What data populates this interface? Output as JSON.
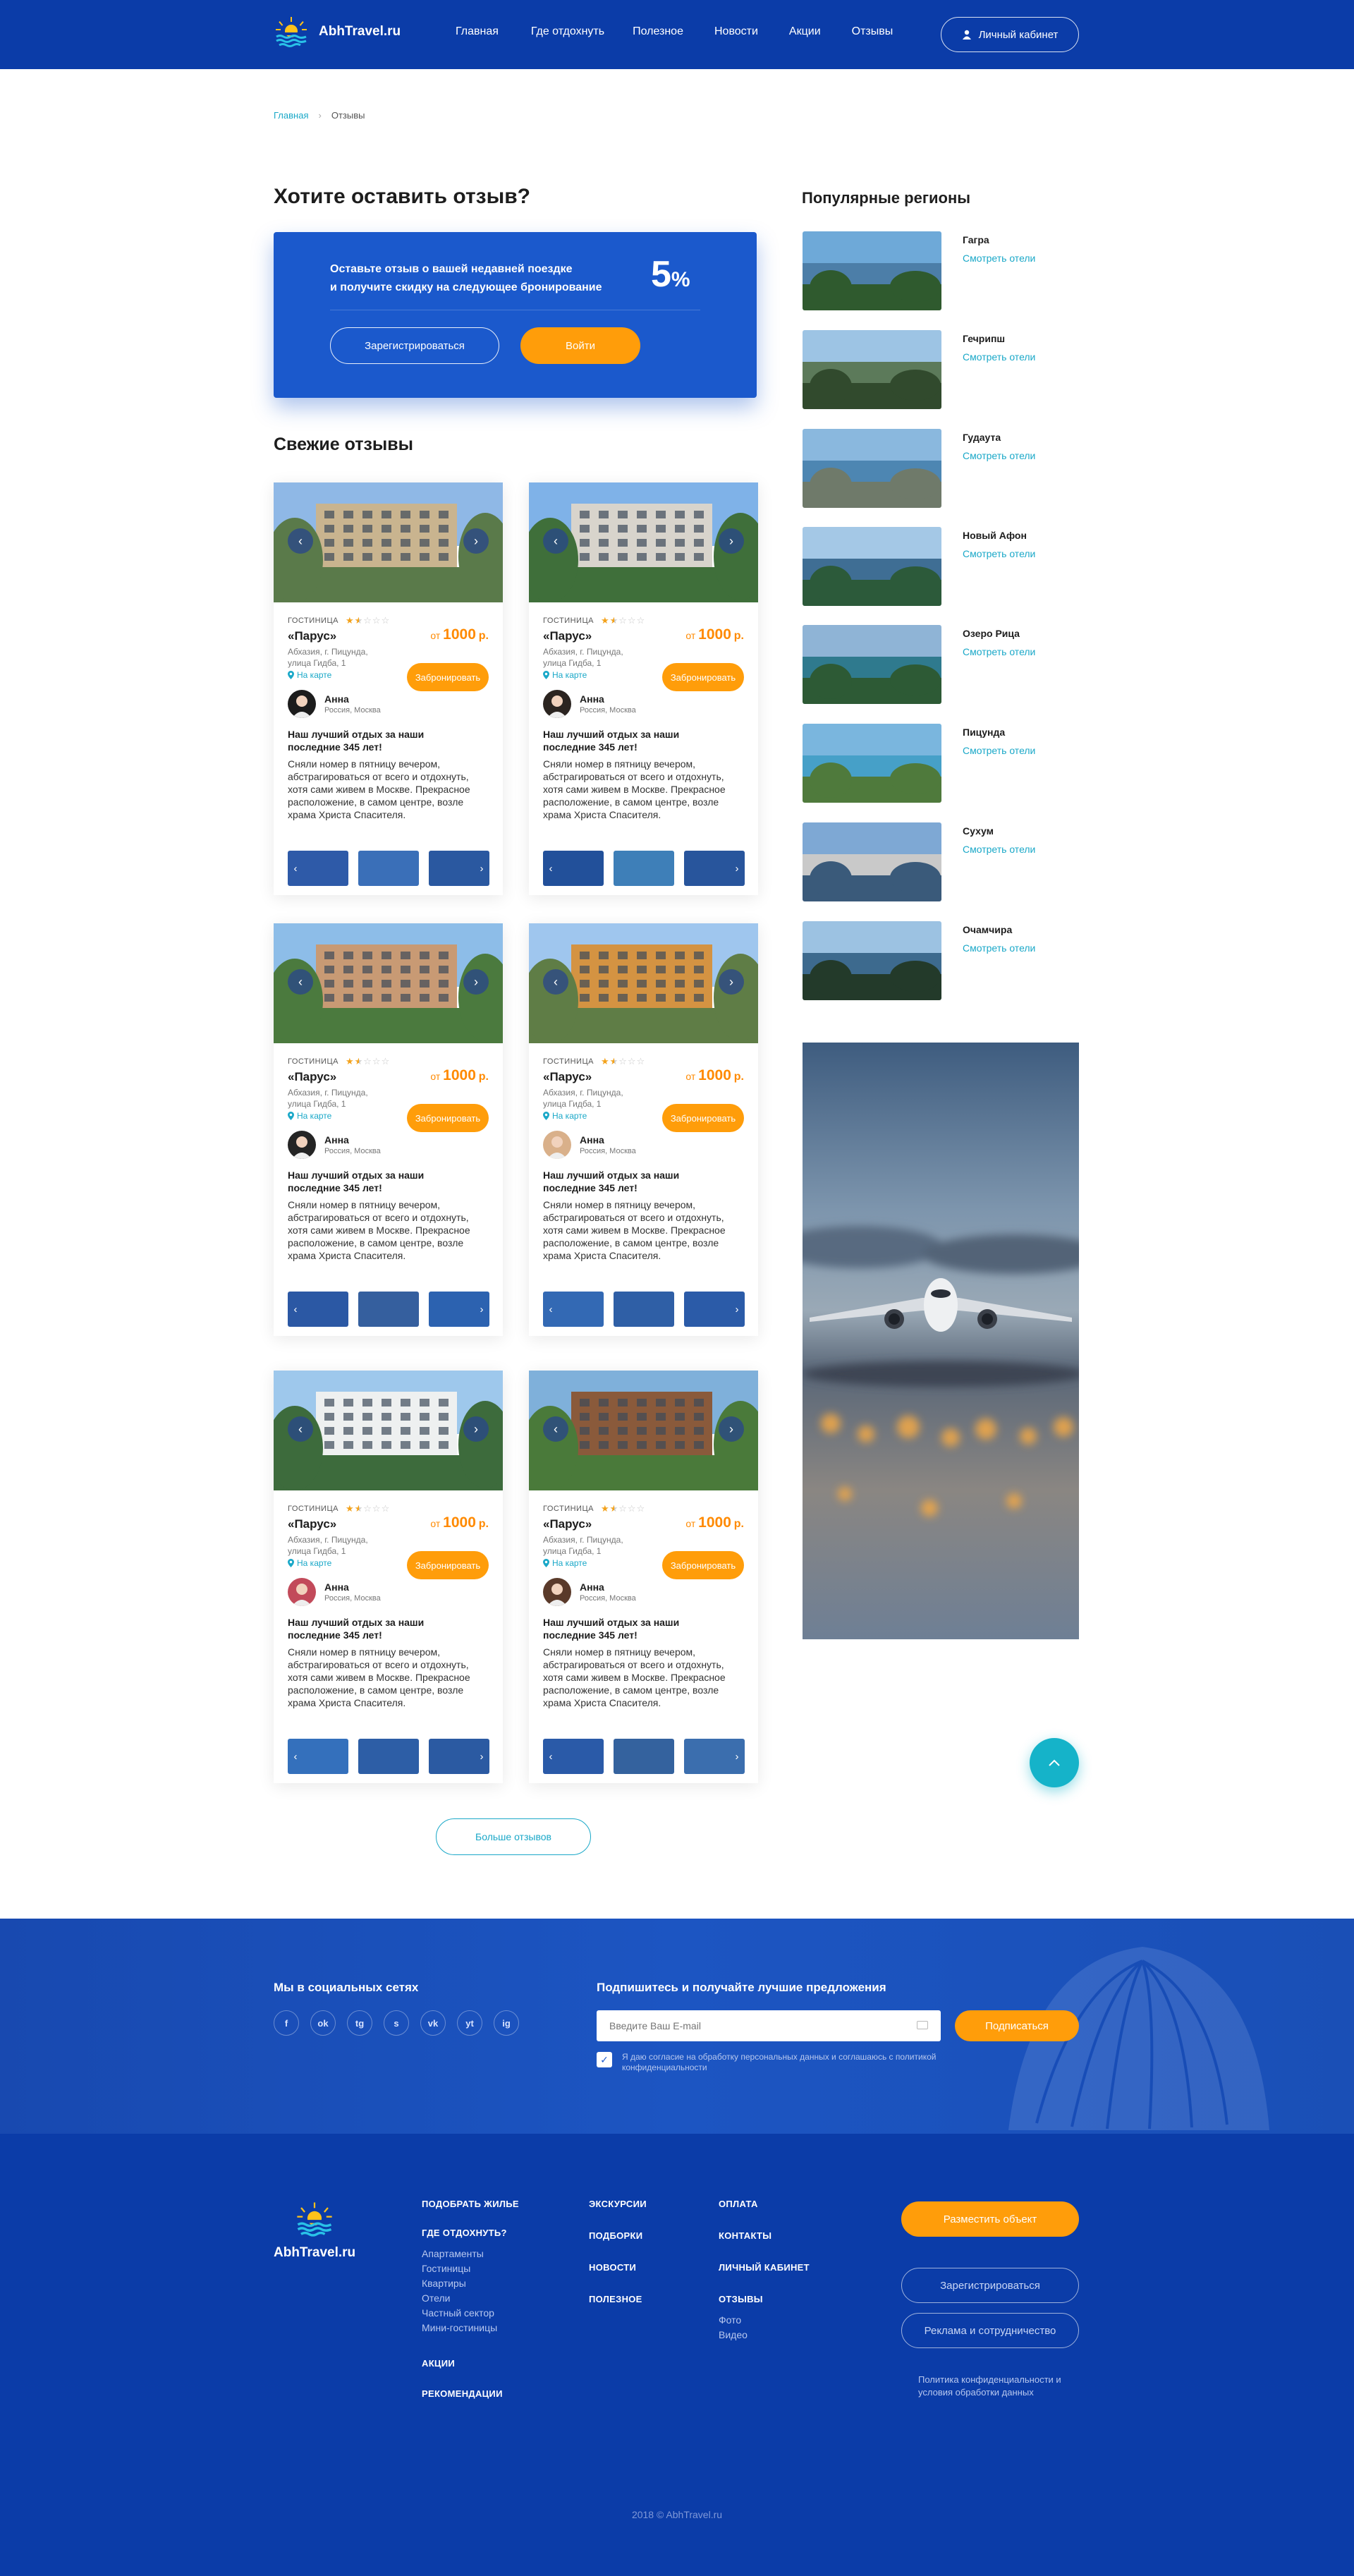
{
  "header": {
    "logo": "AbhTravel.ru",
    "nav": [
      "Главная",
      "Где отдохнуть",
      "Полезное",
      "Новости",
      "Акции",
      "Отзывы"
    ],
    "cabinet": "Личный кабинет"
  },
  "breadcrumb": {
    "home": "Главная",
    "sep": "›",
    "current": "Отзывы"
  },
  "review_cta": {
    "title": "Хотите оставить отзыв?",
    "text_1": "Оставьте отзыв о вашей недавней поездке",
    "text_2": "и получите скидку на следующее бронирование",
    "discount": "5",
    "discount_unit": "%",
    "register": "Зарегистрироваться",
    "login": "Войти"
  },
  "fresh_title": "Свежие отзывы",
  "cards": [
    {
      "type": "ГОСТИНИЦА",
      "name": "«Парус»",
      "price_from": "от",
      "price": "1000",
      "currency": "р.",
      "addr_1": "Абхазия, г. Пицунда,",
      "addr_2": "улица Гидба, 1",
      "map": "На карте",
      "book": "Забронировать",
      "user": "Анна",
      "loc": "Россия, Москва",
      "title": "Наш лучший отдых за наши последние 345 лет!",
      "text": "Сняли номер в пятницу вечером, абстрагироваться от всего и отдохнуть, хотя сами живем в Москве. Прекрасное расположение, в самом центре, возле храма Христа Спасителя."
    },
    {
      "type": "ГОСТИНИЦА",
      "name": "«Парус»",
      "price_from": "от",
      "price": "1000",
      "currency": "р.",
      "addr_1": "Абхазия, г. Пицунда,",
      "addr_2": "улица Гидба, 1",
      "map": "На карте",
      "book": "Забронировать",
      "user": "Анна",
      "loc": "Россия, Москва",
      "title": "Наш лучший отдых за наши последние 345 лет!",
      "text": "Сняли номер в пятницу вечером, абстрагироваться от всего и отдохнуть, хотя сами живем в Москве. Прекрасное расположение, в самом центре, возле храма Христа Спасителя."
    },
    {
      "type": "ГОСТИНИЦА",
      "name": "«Парус»",
      "price_from": "от",
      "price": "1000",
      "currency": "р.",
      "addr_1": "Абхазия, г. Пицунда,",
      "addr_2": "улица Гидба, 1",
      "map": "На карте",
      "book": "Забронировать",
      "user": "Анна",
      "loc": "Россия, Москва",
      "title": "Наш лучший отдых за наши последние 345 лет!",
      "text": "Сняли номер в пятницу вечером, абстрагироваться от всего и отдохнуть, хотя сами живем в Москве. Прекрасное расположение, в самом центре, возле храма Христа Спасителя."
    },
    {
      "type": "ГОСТИНИЦА",
      "name": "«Парус»",
      "price_from": "от",
      "price": "1000",
      "currency": "р.",
      "addr_1": "Абхазия, г. Пицунда,",
      "addr_2": "улица Гидба, 1",
      "map": "На карте",
      "book": "Забронировать",
      "user": "Анна",
      "loc": "Россия, Москва",
      "title": "Наш лучший отдых за наши последние 345 лет!",
      "text": "Сняли номер в пятницу вечером, абстрагироваться от всего и отдохнуть, хотя сами живем в Москве. Прекрасное расположение, в самом центре, возле храма Христа Спасителя."
    },
    {
      "type": "ГОСТИНИЦА",
      "name": "«Парус»",
      "price_from": "от",
      "price": "1000",
      "currency": "р.",
      "addr_1": "Абхазия, г. Пицунда,",
      "addr_2": "улица Гидба, 1",
      "map": "На карте",
      "book": "Забронировать",
      "user": "Анна",
      "loc": "Россия, Москва",
      "title": "Наш лучший отдых за наши последние 345 лет!",
      "text": "Сняли номер в пятницу вечером, абстрагироваться от всего и отдохнуть, хотя сами живем в Москве. Прекрасное расположение, в самом центре, возле храма Христа Спасителя."
    },
    {
      "type": "ГОСТИНИЦА",
      "name": "«Парус»",
      "price_from": "от",
      "price": "1000",
      "currency": "р.",
      "addr_1": "Абхазия, г. Пицунда,",
      "addr_2": "улица Гидба, 1",
      "map": "На карте",
      "book": "Забронировать",
      "user": "Анна",
      "loc": "Россия, Москва",
      "title": "Наш лучший отдых за наши последние 345 лет!",
      "text": "Сняли номер в пятницу вечером, абстрагироваться от всего и отдохнуть, хотя сами живем в Москве. Прекрасное расположение, в самом центре, возле храма Христа Спасителя."
    }
  ],
  "rating": 1.5,
  "rating_max": 5,
  "more_reviews": "Больше отзывов",
  "regions_title": "Популярные регионы",
  "regions": [
    {
      "name": "Гагра",
      "link": "Смотреть отели"
    },
    {
      "name": "Гечрипш",
      "link": "Смотреть отели"
    },
    {
      "name": "Гудаута",
      "link": "Смотреть отели"
    },
    {
      "name": "Новый Афон",
      "link": "Смотреть отели"
    },
    {
      "name": "Озеро Рица",
      "link": "Смотреть отели"
    },
    {
      "name": "Пицунда",
      "link": "Смотреть отели"
    },
    {
      "name": "Сухум",
      "link": "Смотреть отели"
    },
    {
      "name": "Очамчира",
      "link": "Смотреть отели"
    }
  ],
  "subscribe": {
    "social_title": "Мы в социальных сетях",
    "socials": [
      "f",
      "ok",
      "tg",
      "s",
      "vk",
      "yt",
      "ig"
    ],
    "title": "Подпишитесь и получайте лучшие предложения",
    "placeholder": "Введите Ваш E-mail",
    "button": "Подписаться",
    "consent_check": "✓",
    "consent": "Я даю согласие на обработку персональных данных и соглашаюсь с политикой конфиденциальности"
  },
  "footer": {
    "logo": "AbhTravel.ru",
    "col1": {
      "h1": "ПОДОБРАТЬ ЖИЛЬЕ",
      "h2": "ГДЕ ОТДОХНУТЬ?",
      "links": [
        "Апартаменты",
        "Гостиницы",
        "Квартиры",
        "Отели",
        "Частный сектор",
        "Мини-гостиницы"
      ],
      "h3": "АКЦИИ",
      "h4": "РЕКОМЕНДАЦИИ"
    },
    "col2": [
      "ЭКСКУРСИИ",
      "ПОДБОРКИ",
      "НОВОСТИ",
      "ПОЛЕЗНОЕ"
    ],
    "col3": {
      "items": [
        "ОПЛАТА",
        "КОНТАКТЫ",
        "ЛИЧНЫЙ КАБИНЕТ",
        "ОТЗЫВЫ"
      ],
      "links": [
        "Фото",
        "Видео"
      ]
    },
    "place": "Разместить объект",
    "register": "Зарегистрироваться",
    "ads": "Реклама и сотрудничество",
    "policy": "Политика конфиденциальности и условия обработки данных",
    "copyright": "2018 © AbhTravel.ru"
  },
  "colors": {
    "primary": "#0b3ca8",
    "accent": "#ff9d0a",
    "link": "#1aa8c8"
  }
}
